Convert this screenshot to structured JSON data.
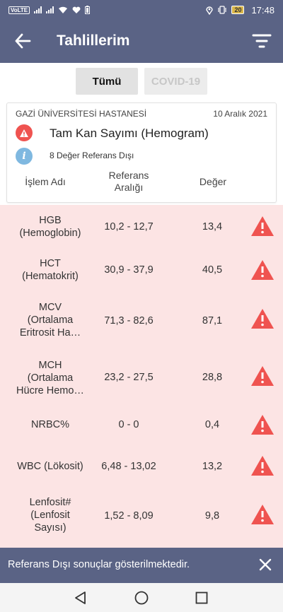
{
  "status_bar": {
    "volte": "VoLTE",
    "battery": "20",
    "time": "17:48"
  },
  "app_bar": {
    "title": "Tahlillerim",
    "back_icon": "arrow-back-icon",
    "filter_icon": "filter-icon"
  },
  "tabs": [
    {
      "label": "Tümü",
      "active": true
    },
    {
      "label": "COVID-19",
      "active": false
    }
  ],
  "card": {
    "hospital": "GAZİ ÜNİVERSİTESİ HASTANESİ",
    "date": "10 Aralık 2021",
    "test_name": "Tam Kan Sayımı (Hemogram)",
    "info": "8 Değer Referans Dışı",
    "warning_icon": "warning-icon",
    "info_icon": "info-icon"
  },
  "columns": {
    "name": "İşlem Adı",
    "ref_line1": "Referans",
    "ref_line2": "Aralığı",
    "value": "Değer"
  },
  "results": [
    {
      "name": [
        "HGB",
        "(Hemoglobin)"
      ],
      "ref": "10,2 - 12,7",
      "value": "13,4"
    },
    {
      "name": [
        "HCT",
        "(Hematokrit)"
      ],
      "ref": "30,9 - 37,9",
      "value": "40,5"
    },
    {
      "name": [
        "MCV",
        "(Ortalama",
        "Eritrosit Ha…"
      ],
      "ref": "71,3 - 82,6",
      "value": "87,1"
    },
    {
      "name": [
        "MCH",
        "(Ortalama",
        "Hücre Hemo…"
      ],
      "ref": "23,2 - 27,5",
      "value": "28,8"
    },
    {
      "name": [
        "NRBC%"
      ],
      "ref": "0 - 0",
      "value": "0,4"
    },
    {
      "name": [
        "WBC (Lökosit)"
      ],
      "ref": "6,48 - 13,02",
      "value": "13,2"
    },
    {
      "name": [
        "Lenfosit#",
        "(Lenfosit",
        "Sayısı)"
      ],
      "ref": "1,52 - 8,09",
      "value": "9,8"
    }
  ],
  "snackbar": {
    "text": "Referans Dışı sonuçlar gösterilmektedir.",
    "close_icon": "close-icon"
  },
  "nav": {
    "back": "nav-back-icon",
    "home": "nav-home-icon",
    "recents": "nav-recents-icon"
  },
  "colors": {
    "primary": "#5a6385",
    "alert": "#ef5350",
    "alert_row_bg": "#fce4e4",
    "info": "#7fb8e0"
  }
}
